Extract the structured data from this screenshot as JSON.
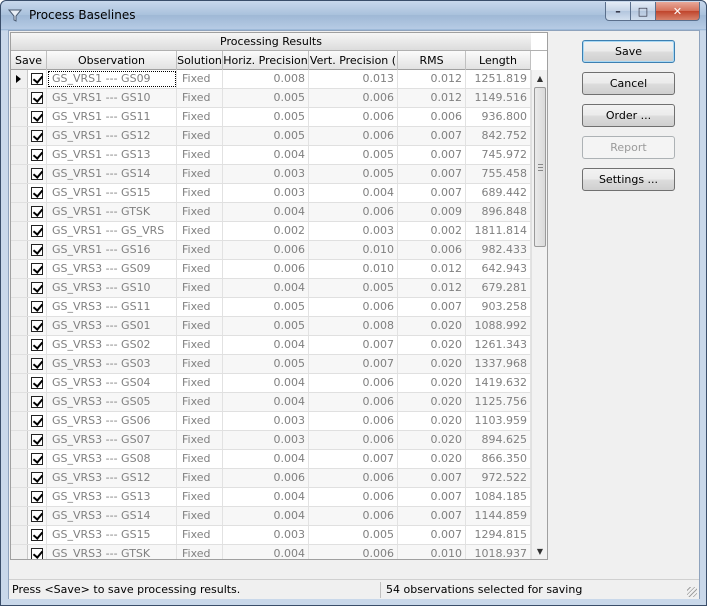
{
  "window": {
    "title": "Process Baselines",
    "controls": {
      "minimize": "–",
      "maximize": "□",
      "close": "✕"
    }
  },
  "grid": {
    "title": "Processing Results",
    "columns": [
      "Save",
      "Observation",
      "Solution",
      "Horiz. Precision",
      "Vert. Precision (",
      "RMS",
      "Length"
    ],
    "rows": [
      {
        "observation": "GS_VRS1 --- GS09",
        "solution": "Fixed",
        "horiz": "0.008",
        "vert": "0.013",
        "rms": "0.012",
        "length": "1251.819",
        "save": true,
        "current": true
      },
      {
        "observation": "GS_VRS1 --- GS10",
        "solution": "Fixed",
        "horiz": "0.005",
        "vert": "0.006",
        "rms": "0.012",
        "length": "1149.516",
        "save": true
      },
      {
        "observation": "GS_VRS1 --- GS11",
        "solution": "Fixed",
        "horiz": "0.005",
        "vert": "0.006",
        "rms": "0.006",
        "length": "936.800",
        "save": true
      },
      {
        "observation": "GS_VRS1 --- GS12",
        "solution": "Fixed",
        "horiz": "0.005",
        "vert": "0.006",
        "rms": "0.007",
        "length": "842.752",
        "save": true
      },
      {
        "observation": "GS_VRS1 --- GS13",
        "solution": "Fixed",
        "horiz": "0.004",
        "vert": "0.005",
        "rms": "0.007",
        "length": "745.972",
        "save": true
      },
      {
        "observation": "GS_VRS1 --- GS14",
        "solution": "Fixed",
        "horiz": "0.003",
        "vert": "0.005",
        "rms": "0.007",
        "length": "755.458",
        "save": true
      },
      {
        "observation": "GS_VRS1 --- GS15",
        "solution": "Fixed",
        "horiz": "0.003",
        "vert": "0.004",
        "rms": "0.007",
        "length": "689.442",
        "save": true
      },
      {
        "observation": "GS_VRS1 --- GTSK",
        "solution": "Fixed",
        "horiz": "0.004",
        "vert": "0.006",
        "rms": "0.009",
        "length": "896.848",
        "save": true
      },
      {
        "observation": "GS_VRS1 --- GS_VRS",
        "solution": "Fixed",
        "horiz": "0.002",
        "vert": "0.003",
        "rms": "0.002",
        "length": "1811.814",
        "save": true
      },
      {
        "observation": "GS_VRS1 --- GS16",
        "solution": "Fixed",
        "horiz": "0.006",
        "vert": "0.010",
        "rms": "0.006",
        "length": "982.433",
        "save": true
      },
      {
        "observation": "GS_VRS3 --- GS09",
        "solution": "Fixed",
        "horiz": "0.006",
        "vert": "0.010",
        "rms": "0.012",
        "length": "642.943",
        "save": true
      },
      {
        "observation": "GS_VRS3 --- GS10",
        "solution": "Fixed",
        "horiz": "0.004",
        "vert": "0.005",
        "rms": "0.012",
        "length": "679.281",
        "save": true
      },
      {
        "observation": "GS_VRS3 --- GS11",
        "solution": "Fixed",
        "horiz": "0.005",
        "vert": "0.006",
        "rms": "0.007",
        "length": "903.258",
        "save": true
      },
      {
        "observation": "GS_VRS3 --- GS01",
        "solution": "Fixed",
        "horiz": "0.005",
        "vert": "0.008",
        "rms": "0.020",
        "length": "1088.992",
        "save": true
      },
      {
        "observation": "GS_VRS3 --- GS02",
        "solution": "Fixed",
        "horiz": "0.004",
        "vert": "0.007",
        "rms": "0.020",
        "length": "1261.343",
        "save": true
      },
      {
        "observation": "GS_VRS3 --- GS03",
        "solution": "Fixed",
        "horiz": "0.005",
        "vert": "0.007",
        "rms": "0.020",
        "length": "1337.968",
        "save": true
      },
      {
        "observation": "GS_VRS3 --- GS04",
        "solution": "Fixed",
        "horiz": "0.004",
        "vert": "0.006",
        "rms": "0.020",
        "length": "1419.632",
        "save": true
      },
      {
        "observation": "GS_VRS3 --- GS05",
        "solution": "Fixed",
        "horiz": "0.004",
        "vert": "0.006",
        "rms": "0.020",
        "length": "1125.756",
        "save": true
      },
      {
        "observation": "GS_VRS3 --- GS06",
        "solution": "Fixed",
        "horiz": "0.003",
        "vert": "0.006",
        "rms": "0.020",
        "length": "1103.959",
        "save": true
      },
      {
        "observation": "GS_VRS3 --- GS07",
        "solution": "Fixed",
        "horiz": "0.003",
        "vert": "0.006",
        "rms": "0.020",
        "length": "894.625",
        "save": true
      },
      {
        "observation": "GS_VRS3 --- GS08",
        "solution": "Fixed",
        "horiz": "0.004",
        "vert": "0.007",
        "rms": "0.020",
        "length": "866.350",
        "save": true
      },
      {
        "observation": "GS_VRS3 --- GS12",
        "solution": "Fixed",
        "horiz": "0.006",
        "vert": "0.006",
        "rms": "0.007",
        "length": "972.522",
        "save": true
      },
      {
        "observation": "GS_VRS3 --- GS13",
        "solution": "Fixed",
        "horiz": "0.004",
        "vert": "0.006",
        "rms": "0.007",
        "length": "1084.185",
        "save": true
      },
      {
        "observation": "GS_VRS3 --- GS14",
        "solution": "Fixed",
        "horiz": "0.004",
        "vert": "0.006",
        "rms": "0.007",
        "length": "1144.859",
        "save": true
      },
      {
        "observation": "GS_VRS3 --- GS15",
        "solution": "Fixed",
        "horiz": "0.003",
        "vert": "0.005",
        "rms": "0.007",
        "length": "1294.815",
        "save": true
      },
      {
        "observation": "GS_VRS3 --- GTSK",
        "solution": "Fixed",
        "horiz": "0.004",
        "vert": "0.006",
        "rms": "0.010",
        "length": "1018.937",
        "save": true
      }
    ]
  },
  "buttons": {
    "save": "Save",
    "cancel": "Cancel",
    "order": "Order ...",
    "report": "Report",
    "settings": "Settings ..."
  },
  "status": {
    "hint": "Press <Save> to save processing results.",
    "count": "54 observations selected for saving"
  },
  "icons": {
    "app": "filter-funnel-icon",
    "scroll_up": "scroll-up-arrow-icon",
    "scroll_down": "scroll-down-arrow-icon"
  }
}
